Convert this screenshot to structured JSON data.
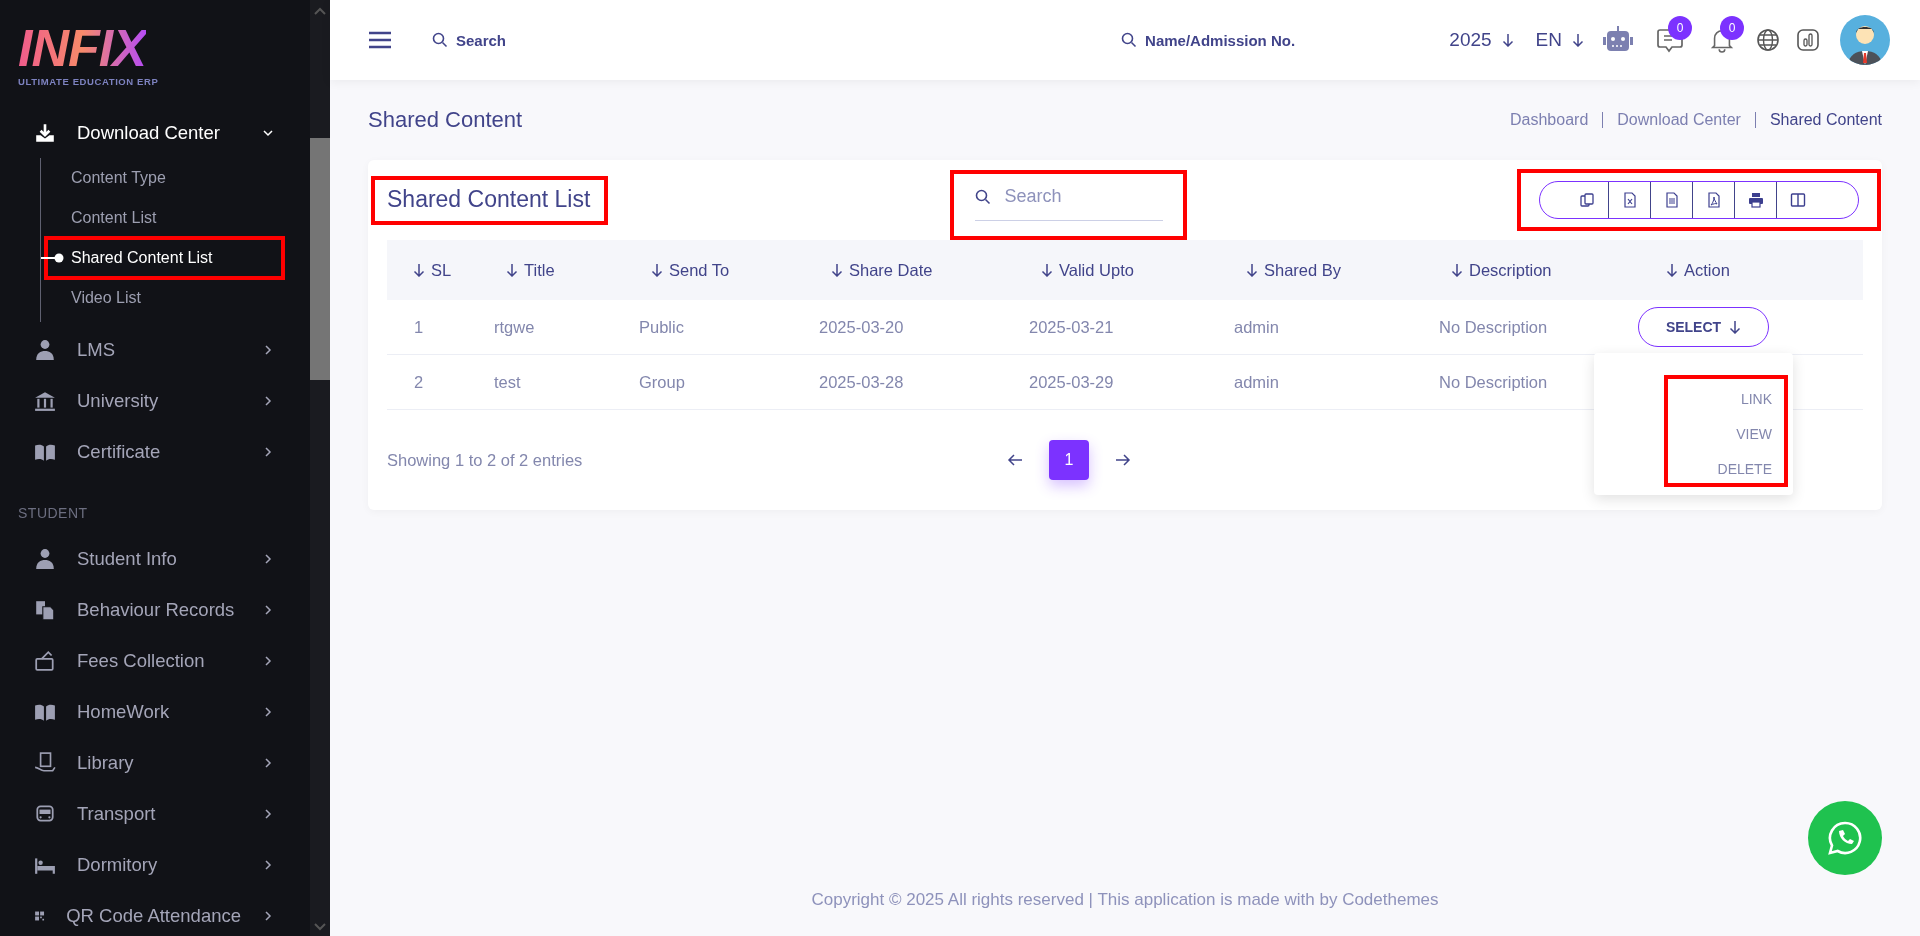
{
  "sidebar": {
    "logo": {
      "wordmark": "INFIX",
      "tagline": "ULTIMATE EDUCATION ERP"
    },
    "groups": [
      {
        "items": [
          {
            "label": "Download Center",
            "expanded": true,
            "children": [
              {
                "label": "Content Type",
                "selected": false,
                "highlighted": false
              },
              {
                "label": "Content List",
                "selected": false,
                "highlighted": false
              },
              {
                "label": "Shared Content List",
                "selected": true,
                "highlighted": true
              },
              {
                "label": "Video List",
                "selected": false,
                "highlighted": false
              }
            ]
          },
          {
            "label": "LMS",
            "expanded": false
          },
          {
            "label": "University",
            "expanded": false
          },
          {
            "label": "Certificate",
            "expanded": false
          }
        ]
      },
      {
        "heading": "STUDENT",
        "items": [
          {
            "label": "Student Info",
            "expanded": false
          },
          {
            "label": "Behaviour Records",
            "expanded": false
          },
          {
            "label": "Fees Collection",
            "expanded": false
          },
          {
            "label": "HomeWork",
            "expanded": false
          },
          {
            "label": "Library",
            "expanded": false
          },
          {
            "label": "Transport",
            "expanded": false
          },
          {
            "label": "Dormitory",
            "expanded": false
          },
          {
            "label": "QR Code Attendance",
            "expanded": false
          }
        ]
      }
    ]
  },
  "header": {
    "search_placeholder": "Search",
    "student_search_placeholder": "Name/Admission No.",
    "year": "2025",
    "language": "EN",
    "chat_count": "0",
    "notification_count": "0"
  },
  "page": {
    "title": "Shared Content",
    "breadcrumb": [
      {
        "label": "Dashboard",
        "current": false
      },
      {
        "label": "Download Center",
        "current": false
      },
      {
        "label": "Shared Content",
        "current": true
      }
    ]
  },
  "card": {
    "title": "Shared Content List",
    "title_highlighted": true,
    "search": {
      "placeholder": "Search",
      "highlighted": true
    },
    "export_toolbar": {
      "highlighted": true
    },
    "table": {
      "columns": [
        "SL",
        "Title",
        "Send To",
        "Share Date",
        "Valid Upto",
        "Shared By",
        "Description",
        "Action"
      ],
      "rows": [
        {
          "cells": [
            "1",
            "rtgwe",
            "Public",
            "2025-03-20",
            "2025-03-21",
            "admin",
            "No Description"
          ],
          "action": {
            "label": "SELECT",
            "open": true,
            "menu_highlighted": true,
            "menu": [
              "LINK",
              "VIEW",
              "DELETE"
            ]
          }
        },
        {
          "cells": [
            "2",
            "test",
            "Group",
            "2025-03-28",
            "2025-03-29",
            "admin",
            "No Description"
          ]
        }
      ]
    },
    "info": "Showing 1 to 2 of 2 entries",
    "pagination": {
      "pages": [
        {
          "label": "1",
          "selected": true
        }
      ]
    }
  },
  "footer": "Copyright © 2025 All rights reserved | This application is made with by Codethemes"
}
